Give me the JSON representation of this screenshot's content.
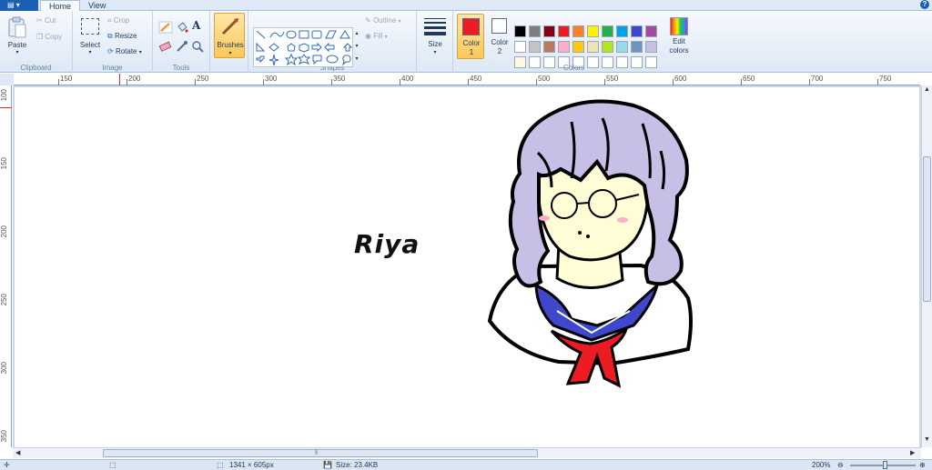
{
  "tabs": {
    "app_menu": "",
    "home": "Home",
    "view": "View",
    "help": "?"
  },
  "clipboard": {
    "paste": "Paste",
    "cut": "Cut",
    "copy": "Copy",
    "label": "Clipboard"
  },
  "image": {
    "select": "Select",
    "crop": "Crop",
    "resize": "Resize",
    "rotate": "Rotate",
    "label": "Image"
  },
  "tools": {
    "label": "Tools"
  },
  "brushes": {
    "label": "Brushes"
  },
  "shapes": {
    "outline": "Outline",
    "fill": "Fill",
    "label": "Shapes"
  },
  "size": {
    "label": "Size"
  },
  "color1": {
    "label": "Color",
    "num": "1",
    "value": "#ed1c24"
  },
  "color2": {
    "label": "Color",
    "num": "2",
    "value": "#ffffff"
  },
  "colors": {
    "label": "Colors",
    "edit": "Edit colors",
    "row1": [
      "#000000",
      "#7f7f7f",
      "#880015",
      "#ed1c24",
      "#ff7f27",
      "#fff200",
      "#22b14c",
      "#00a2e8",
      "#3f48cc",
      "#a349a4"
    ],
    "row2": [
      "#ffffff",
      "#c3c3c3",
      "#b97a57",
      "#ffaec9",
      "#ffc90e",
      "#efe4b0",
      "#b5e61d",
      "#99d9ea",
      "#7092be",
      "#c8bfe7"
    ],
    "row3": [
      "#fdf8e1",
      "#ffffff",
      "#ffffff",
      "#ffffff",
      "#ffffff",
      "#ffffff",
      "#ffffff",
      "#ffffff",
      "#ffffff",
      "#ffffff"
    ]
  },
  "ruler_h": [
    "150",
    "200",
    "250",
    "300",
    "350",
    "400",
    "450",
    "500",
    "550",
    "600",
    "650",
    "700",
    "750"
  ],
  "ruler_v": [
    "100",
    "150",
    "200",
    "250",
    "300",
    "350"
  ],
  "canvas": {
    "text": "Riya"
  },
  "status": {
    "dimensions": "1341 × 605px",
    "size": "Size: 23.4KB",
    "zoom": "200%"
  }
}
